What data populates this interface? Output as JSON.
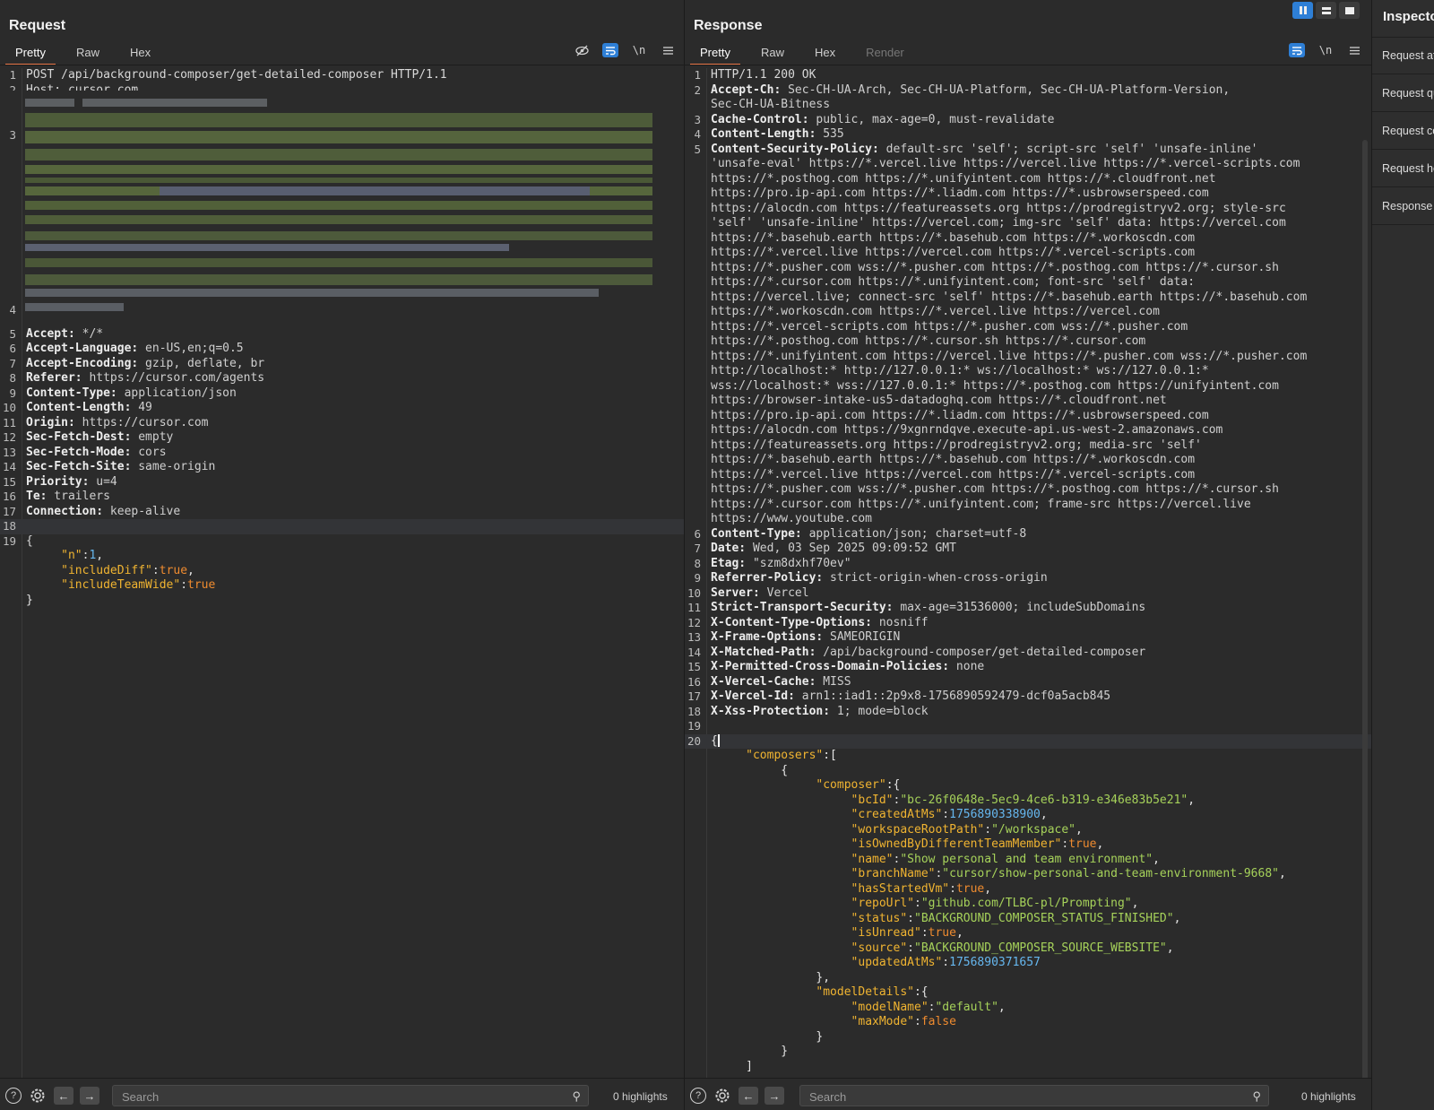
{
  "request": {
    "title": "Request",
    "tabs": [
      "Pretty",
      "Raw",
      "Hex"
    ],
    "active_tab": "Pretty",
    "toolbar": {
      "hide_icon": "eye-off-icon",
      "wrap_icon": "wrap-icon",
      "newline_label": "\\n",
      "menu_icon": "menu-icon"
    },
    "lines": [
      {
        "n": "1",
        "t": "POST /api/background-composer/get-detailed-composer HTTP/1.1"
      },
      {
        "n": "2",
        "t": "Host: cursor.com"
      },
      {
        "n": "5",
        "k": "Accept:",
        "v": " */*"
      },
      {
        "n": "6",
        "k": "Accept-Language:",
        "v": " en-US,en;q=0.5"
      },
      {
        "n": "7",
        "k": "Accept-Encoding:",
        "v": " gzip, deflate, br"
      },
      {
        "n": "8",
        "k": "Referer:",
        "v": " https://cursor.com/agents"
      },
      {
        "n": "9",
        "k": "Content-Type:",
        "v": " application/json"
      },
      {
        "n": "10",
        "k": "Content-Length:",
        "v": " 49"
      },
      {
        "n": "11",
        "k": "Origin:",
        "v": " https://cursor.com"
      },
      {
        "n": "12",
        "k": "Sec-Fetch-Dest:",
        "v": " empty"
      },
      {
        "n": "13",
        "k": "Sec-Fetch-Mode:",
        "v": " cors"
      },
      {
        "n": "14",
        "k": "Sec-Fetch-Site:",
        "v": " same-origin"
      },
      {
        "n": "15",
        "k": "Priority:",
        "v": " u=4"
      },
      {
        "n": "16",
        "k": "Te:",
        "v": " trailers"
      },
      {
        "n": "17",
        "k": "Connection:",
        "v": " keep-alive"
      },
      {
        "n": "18",
        "t": ""
      },
      {
        "n": "19",
        "t": "{"
      }
    ],
    "body": [
      {
        "key": "\"n\"",
        "val": "1",
        "type": "num",
        "comma": ","
      },
      {
        "key": "\"includeDiff\"",
        "val": "true",
        "type": "bool",
        "comma": ","
      },
      {
        "key": "\"includeTeamWide\"",
        "val": "true",
        "type": "bool",
        "comma": ""
      }
    ],
    "close": "}",
    "blur_line_numbers": [
      "3",
      "4"
    ],
    "search_placeholder": "Search",
    "highlights": "0 highlights"
  },
  "response": {
    "title": "Response",
    "tabs": [
      "Pretty",
      "Raw",
      "Hex",
      "Render"
    ],
    "active_tab": "Pretty",
    "toolbar": {
      "wrap_icon": "wrap-icon",
      "newline_label": "\\n",
      "menu_icon": "menu-icon"
    },
    "lines": [
      {
        "n": "1",
        "t": "HTTP/1.1 200 OK"
      },
      {
        "n": "2",
        "k": "Accept-Ch:",
        "v": " Sec-CH-UA-Arch, Sec-CH-UA-Platform, Sec-CH-UA-Platform-Version,"
      },
      {
        "n": "",
        "v": "Sec-CH-UA-Bitness"
      },
      {
        "n": "3",
        "k": "Cache-Control:",
        "v": " public, max-age=0, must-revalidate"
      },
      {
        "n": "4",
        "k": "Content-Length:",
        "v": " 535"
      },
      {
        "n": "5",
        "k": "Content-Security-Policy:",
        "v": " default-src 'self'; script-src 'self' 'unsafe-inline'"
      },
      {
        "n": "",
        "v": "'unsafe-eval' https://*.vercel.live https://vercel.live https://*.vercel-scripts.com"
      },
      {
        "n": "",
        "v": "https://*.posthog.com https://*.unifyintent.com https://*.cloudfront.net"
      },
      {
        "n": "",
        "v": "https://pro.ip-api.com https://*.liadm.com https://*.usbrowserspeed.com"
      },
      {
        "n": "",
        "v": "https://alocdn.com https://featureassets.org https://prodregistryv2.org; style-src"
      },
      {
        "n": "",
        "v": "'self' 'unsafe-inline' https://vercel.com; img-src 'self' data: https://vercel.com"
      },
      {
        "n": "",
        "v": "https://*.basehub.earth https://*.basehub.com https://*.workoscdn.com"
      },
      {
        "n": "",
        "v": "https://*.vercel.live https://vercel.com https://*.vercel-scripts.com"
      },
      {
        "n": "",
        "v": "https://*.pusher.com wss://*.pusher.com https://*.posthog.com https://*.cursor.sh"
      },
      {
        "n": "",
        "v": "https://*.cursor.com https://*.unifyintent.com; font-src 'self' data:"
      },
      {
        "n": "",
        "v": "https://vercel.live; connect-src 'self' https://*.basehub.earth https://*.basehub.com"
      },
      {
        "n": "",
        "v": "https://*.workoscdn.com https://*.vercel.live https://vercel.com"
      },
      {
        "n": "",
        "v": "https://*.vercel-scripts.com https://*.pusher.com wss://*.pusher.com"
      },
      {
        "n": "",
        "v": "https://*.posthog.com https://*.cursor.sh https://*.cursor.com"
      },
      {
        "n": "",
        "v": "https://*.unifyintent.com https://vercel.live https://*.pusher.com wss://*.pusher.com"
      },
      {
        "n": "",
        "v": "http://localhost:* http://127.0.0.1:* ws://localhost:* ws://127.0.0.1:*"
      },
      {
        "n": "",
        "v": "wss://localhost:* wss://127.0.0.1:* https://*.posthog.com https://unifyintent.com"
      },
      {
        "n": "",
        "v": "https://browser-intake-us5-datadoghq.com https://*.cloudfront.net"
      },
      {
        "n": "",
        "v": "https://pro.ip-api.com https://*.liadm.com https://*.usbrowserspeed.com"
      },
      {
        "n": "",
        "v": "https://alocdn.com https://9xgnrndqve.execute-api.us-west-2.amazonaws.com"
      },
      {
        "n": "",
        "v": "https://featureassets.org https://prodregistryv2.org; media-src 'self'"
      },
      {
        "n": "",
        "v": "https://*.basehub.earth https://*.basehub.com https://*.workoscdn.com"
      },
      {
        "n": "",
        "v": "https://*.vercel.live https://vercel.com https://*.vercel-scripts.com"
      },
      {
        "n": "",
        "v": "https://*.pusher.com wss://*.pusher.com https://*.posthog.com https://*.cursor.sh"
      },
      {
        "n": "",
        "v": "https://*.cursor.com https://*.unifyintent.com; frame-src https://vercel.live"
      },
      {
        "n": "",
        "v": "https://www.youtube.com"
      },
      {
        "n": "6",
        "k": "Content-Type:",
        "v": " application/json; charset=utf-8"
      },
      {
        "n": "7",
        "k": "Date:",
        "v": " Wed, 03 Sep 2025 09:09:52 GMT"
      },
      {
        "n": "8",
        "k": "Etag:",
        "v": " \"szm8dxhf70ev\""
      },
      {
        "n": "9",
        "k": "Referrer-Policy:",
        "v": " strict-origin-when-cross-origin"
      },
      {
        "n": "10",
        "k": "Server:",
        "v": " Vercel"
      },
      {
        "n": "11",
        "k": "Strict-Transport-Security:",
        "v": " max-age=31536000; includeSubDomains"
      },
      {
        "n": "12",
        "k": "X-Content-Type-Options:",
        "v": " nosniff"
      },
      {
        "n": "13",
        "k": "X-Frame-Options:",
        "v": " SAMEORIGIN"
      },
      {
        "n": "14",
        "k": "X-Matched-Path:",
        "v": " /api/background-composer/get-detailed-composer"
      },
      {
        "n": "15",
        "k": "X-Permitted-Cross-Domain-Policies:",
        "v": " none"
      },
      {
        "n": "16",
        "k": "X-Vercel-Cache:",
        "v": " MISS"
      },
      {
        "n": "17",
        "k": "X-Vercel-Id:",
        "v": " arn1::iad1::2p9x8-1756890592479-dcf0a5acb845"
      },
      {
        "n": "18",
        "k": "X-Xss-Protection:",
        "v": " 1; mode=block"
      },
      {
        "n": "19",
        "t": ""
      }
    ],
    "json": [
      {
        "indent": 0,
        "p": "{",
        "cursor": true,
        "n": "20"
      },
      {
        "indent": 1,
        "key": "\"composers\"",
        "p": ":["
      },
      {
        "indent": 2,
        "p": "{"
      },
      {
        "indent": 3,
        "key": "\"composer\"",
        "p": ":{"
      },
      {
        "indent": 4,
        "key": "\"bcId\"",
        "val": "\"bc-26f0648e-5ec9-4ce6-b319-e346e83b5e21\"",
        "type": "str",
        "p": ","
      },
      {
        "indent": 4,
        "key": "\"createdAtMs\"",
        "val": "1756890338900",
        "type": "num",
        "p": ","
      },
      {
        "indent": 4,
        "key": "\"workspaceRootPath\"",
        "val": "\"/workspace\"",
        "type": "str",
        "p": ","
      },
      {
        "indent": 4,
        "key": "\"isOwnedByDifferentTeamMember\"",
        "val": "true",
        "type": "bool",
        "p": ","
      },
      {
        "indent": 4,
        "key": "\"name\"",
        "val": "\"Show personal and team environment\"",
        "type": "str",
        "p": ","
      },
      {
        "indent": 4,
        "key": "\"branchName\"",
        "val": "\"cursor/show-personal-and-team-environment-9668\"",
        "type": "str",
        "p": ","
      },
      {
        "indent": 4,
        "key": "\"hasStartedVm\"",
        "val": "true",
        "type": "bool",
        "p": ","
      },
      {
        "indent": 4,
        "key": "\"repoUrl\"",
        "val": "\"github.com/TLBC-pl/Prompting\"",
        "type": "str",
        "p": ","
      },
      {
        "indent": 4,
        "key": "\"status\"",
        "val": "\"BACKGROUND_COMPOSER_STATUS_FINISHED\"",
        "type": "str",
        "p": ","
      },
      {
        "indent": 4,
        "key": "\"isUnread\"",
        "val": "true",
        "type": "bool",
        "p": ","
      },
      {
        "indent": 4,
        "key": "\"source\"",
        "val": "\"BACKGROUND_COMPOSER_SOURCE_WEBSITE\"",
        "type": "str",
        "p": ","
      },
      {
        "indent": 4,
        "key": "\"updatedAtMs\"",
        "val": "1756890371657",
        "type": "num",
        "p": ""
      },
      {
        "indent": 3,
        "p": "},"
      },
      {
        "indent": 3,
        "key": "\"modelDetails\"",
        "p": ":{"
      },
      {
        "indent": 4,
        "key": "\"modelName\"",
        "val": "\"default\"",
        "type": "str",
        "p": ","
      },
      {
        "indent": 4,
        "key": "\"maxMode\"",
        "val": "false",
        "type": "bool",
        "p": ""
      },
      {
        "indent": 3,
        "p": "}"
      },
      {
        "indent": 2,
        "p": "}"
      },
      {
        "indent": 1,
        "p": "]"
      }
    ],
    "search_placeholder": "Search",
    "highlights": "0 highlights"
  },
  "inspector": {
    "title": "Inspector",
    "items": [
      "Request attributes",
      "Request query parameters",
      "Request cookies",
      "Request headers",
      "Response headers"
    ]
  },
  "colors": {
    "accent": "#2e7fd6",
    "tab_underline": "#e8784a",
    "json_key": "#f0b431",
    "json_string": "#a6d25a",
    "json_number": "#66b7ef",
    "json_bool": "#ef8b2f"
  }
}
